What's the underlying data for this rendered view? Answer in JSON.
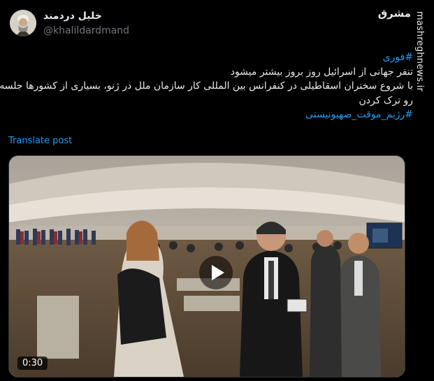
{
  "author": {
    "display_name": "خلیل دردمند",
    "handle": "@khalildardmand"
  },
  "tweet": {
    "lines": [
      {
        "text": "#فوری",
        "hashtag": true
      },
      {
        "text": "تنفر جهانی از اسرائیل روز بروز بیشتر میشود",
        "hashtag": false
      },
      {
        "text": "با شروع سخنران اسقاطیلی در کنفرانس بین المللی کار سازمان ملل در ژنو، بسیاری از کشورها جلسه",
        "hashtag": false
      },
      {
        "text": "رو ترک کردن",
        "hashtag": false
      },
      {
        "text": "#رژیم_موقت_صهیونیستی",
        "hashtag": true
      }
    ],
    "translate_label": "Translate post"
  },
  "video": {
    "duration": "0:30"
  },
  "watermark": {
    "logo_text": "مشرق",
    "site": "mashreghnews.ir"
  },
  "colors": {
    "link": "#1d9bf0",
    "background": "#000000",
    "text": "#e7e9ea",
    "muted": "#71767b"
  }
}
